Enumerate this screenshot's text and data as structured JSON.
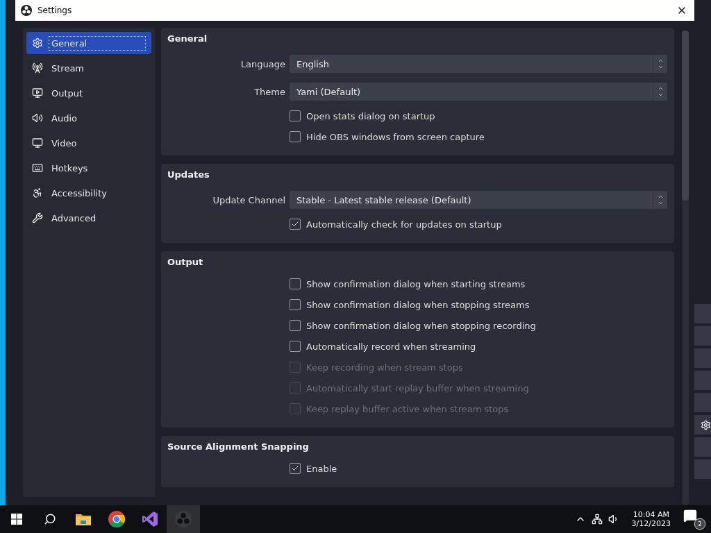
{
  "window": {
    "title": "Settings"
  },
  "sidebar": {
    "items": [
      {
        "label": "General",
        "selected": true
      },
      {
        "label": "Stream",
        "selected": false
      },
      {
        "label": "Output",
        "selected": false
      },
      {
        "label": "Audio",
        "selected": false
      },
      {
        "label": "Video",
        "selected": false
      },
      {
        "label": "Hotkeys",
        "selected": false
      },
      {
        "label": "Accessibility",
        "selected": false
      },
      {
        "label": "Advanced",
        "selected": false
      }
    ]
  },
  "sections": [
    {
      "title": "General",
      "rows": [
        {
          "kind": "select",
          "label": "Language",
          "value": "English"
        },
        {
          "kind": "select",
          "label": "Theme",
          "value": "Yami (Default)"
        },
        {
          "kind": "checkbox",
          "label": "Open stats dialog on startup",
          "checked": false,
          "disabled": false
        },
        {
          "kind": "checkbox",
          "label": "Hide OBS windows from screen capture",
          "checked": false,
          "disabled": false
        }
      ]
    },
    {
      "title": "Updates",
      "rows": [
        {
          "kind": "select",
          "label": "Update Channel",
          "value": "Stable - Latest stable release (Default)"
        },
        {
          "kind": "checkbox",
          "label": "Automatically check for updates on startup",
          "checked": true,
          "disabled": false
        }
      ]
    },
    {
      "title": "Output",
      "rows": [
        {
          "kind": "checkbox",
          "label": "Show confirmation dialog when starting streams",
          "checked": false,
          "disabled": false
        },
        {
          "kind": "checkbox",
          "label": "Show confirmation dialog when stopping streams",
          "checked": false,
          "disabled": false
        },
        {
          "kind": "checkbox",
          "label": "Show confirmation dialog when stopping recording",
          "checked": false,
          "disabled": false
        },
        {
          "kind": "checkbox",
          "label": "Automatically record when streaming",
          "checked": false,
          "disabled": false
        },
        {
          "kind": "checkbox",
          "label": "Keep recording when stream stops",
          "checked": false,
          "disabled": true
        },
        {
          "kind": "checkbox",
          "label": "Automatically start replay buffer when streaming",
          "checked": false,
          "disabled": true
        },
        {
          "kind": "checkbox",
          "label": "Keep replay buffer active when stream stops",
          "checked": false,
          "disabled": true
        }
      ]
    },
    {
      "title": "Source Alignment Snapping",
      "rows": [
        {
          "kind": "checkbox",
          "label": "Enable",
          "checked": true,
          "disabled": false
        }
      ]
    }
  ],
  "taskbar": {
    "time": "10:04 AM",
    "date": "3/12/2023",
    "notifications": "2"
  }
}
